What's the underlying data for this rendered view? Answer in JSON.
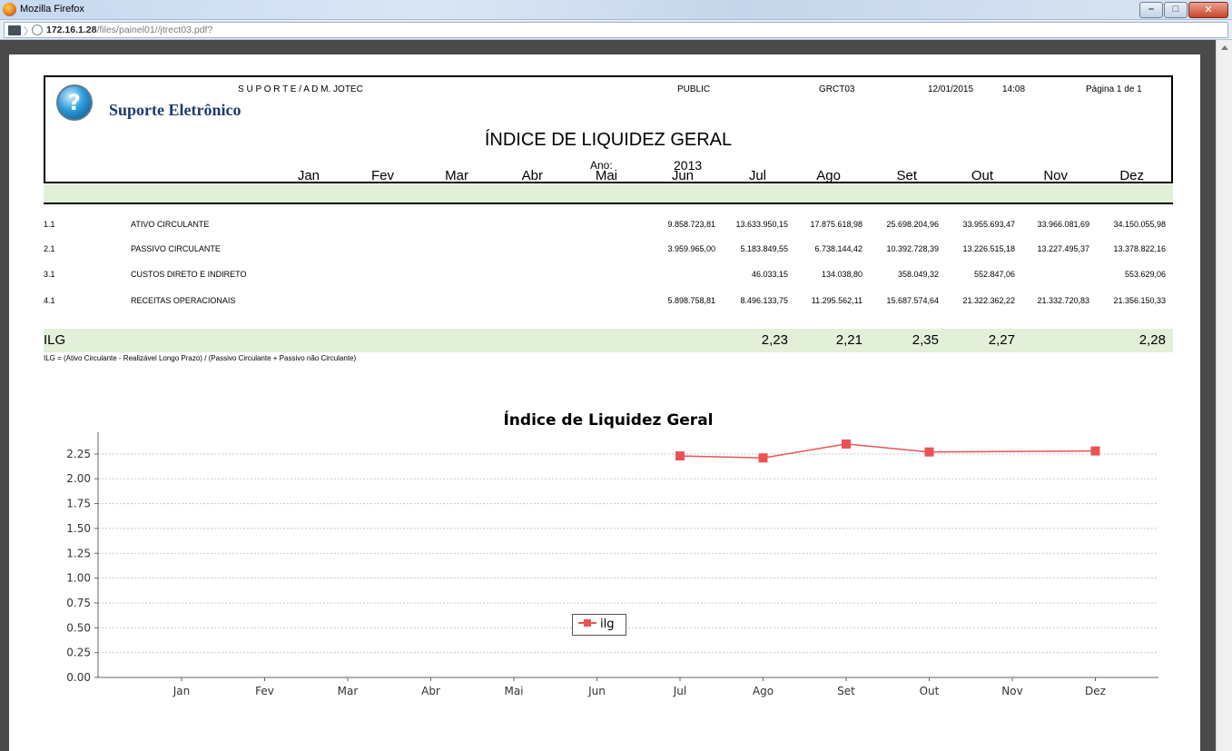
{
  "window": {
    "title": "Mozilla Firefox",
    "url_host": "172.16.1.28",
    "url_path": "/files/painel01//jtrect03.pdf?"
  },
  "report": {
    "brand": "Suporte Eletrônico",
    "org": "S U P O R T E /  A D M. JOTEC",
    "schema": "PUBLIC",
    "code": "GRCT03",
    "date": "12/01/2015",
    "time": "14:08",
    "page": "Página 1 de   1",
    "title": "ÍNDICE DE LIQUIDEZ GERAL",
    "year_label": "Ano:",
    "year": "2013"
  },
  "table": {
    "months": [
      "Jan",
      "Fev",
      "Mar",
      "Abr",
      "Mai",
      "Jun",
      "Jul",
      "Ago",
      "Set",
      "Out",
      "Nov",
      "Dez"
    ],
    "rows": [
      {
        "code": "1.1",
        "label": "ATIVO CIRCULANTE",
        "values": [
          "",
          "",
          "",
          "",
          "",
          "9.858.723,81",
          "13.633.950,15",
          "17.875.618,98",
          "25.698.204,96",
          "33.955.693,47",
          "33.966.081,69",
          "34.150.055,98"
        ]
      },
      {
        "code": "2.1",
        "label": "PASSIVO CIRCULANTE",
        "values": [
          "",
          "",
          "",
          "",
          "",
          "3.959.965,00",
          "5.183.849,55",
          "6.738.144,42",
          "10.392.728,39",
          "13.226.515,18",
          "13.227.495,37",
          "13.378.822,16"
        ]
      },
      {
        "code": "3.1",
        "label": "CUSTOS DIRETO E INDIRETO",
        "values": [
          "",
          "",
          "",
          "",
          "",
          "",
          "46.033,15",
          "134.038,80",
          "358.049,32",
          "552.847,06",
          "",
          "553.629,06"
        ]
      },
      {
        "code": "4.1",
        "label": "RECEITAS OPERACIONAIS",
        "values": [
          "",
          "",
          "",
          "",
          "",
          "5.898.758,81",
          "8.496.133,75",
          "11.295.562,11",
          "15.687.574,64",
          "21.322.362,22",
          "21.332.720,83",
          "21.356.150,33"
        ]
      }
    ],
    "ilg_label": "ILG",
    "ilg_values": [
      "",
      "",
      "",
      "",
      "",
      "",
      "2,23",
      "2,21",
      "2,35",
      "2,27",
      "",
      "2,28"
    ],
    "formula": "ILG = (Ativo Circulante - Realizável Longo Prazo) / (Passivo Circulante + Passivo não Circulante)"
  },
  "chart_data": {
    "type": "line",
    "title": "Índice de Liquidez Geral",
    "categories": [
      "Jan",
      "Fev",
      "Mar",
      "Abr",
      "Mai",
      "Jun",
      "Jul",
      "Ago",
      "Set",
      "Out",
      "Nov",
      "Dez"
    ],
    "series": [
      {
        "name": "ilg",
        "color": "#e85454",
        "values": [
          null,
          null,
          null,
          null,
          null,
          null,
          2.23,
          2.21,
          2.35,
          2.27,
          null,
          2.28
        ]
      }
    ],
    "yticks": [
      "0.00",
      "0.25",
      "0.50",
      "0.75",
      "1.00",
      "1.25",
      "1.50",
      "1.75",
      "2.00",
      "2.25"
    ],
    "ylim": [
      0,
      2.45
    ],
    "grid": true,
    "legend": "bottom-center"
  }
}
